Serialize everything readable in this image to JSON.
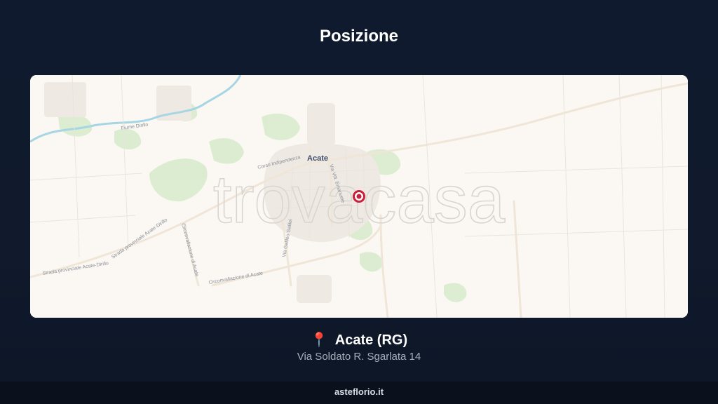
{
  "page": {
    "title": "Posizione"
  },
  "map": {
    "watermark": "trovacasa",
    "place_label": "Acate",
    "street_labels": [
      "Fiume Dirillo",
      "Corso Indipendenza",
      "Via Vitt. Emanuele",
      "Via Galileo Galilei",
      "Strada provinciale Acate-Dirillo",
      "Strada provinciale Acate-Dirillo",
      "Circonvallazione di Acate",
      "Circonvallazione di Acate"
    ],
    "marker_icon": "map-pin-icon",
    "colors": {
      "marker": "#c8203a",
      "water": "#9fd3e0",
      "green": "#cfe6c3"
    }
  },
  "location": {
    "pin_icon": "📍",
    "name": "Acate (RG)",
    "address": "Via Soldato R. Sgarlata 14"
  },
  "footer": {
    "site": "asteflorio.it"
  }
}
